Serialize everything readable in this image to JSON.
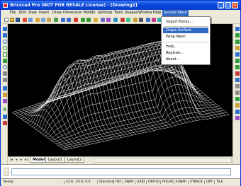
{
  "window": {
    "title": "Bricscad Pro (NOT FOR RESALE License) - [Drawing2]",
    "controls": [
      "_",
      "□",
      "×"
    ]
  },
  "menubar": {
    "items": [
      "File",
      "Edit",
      "View",
      "Insert",
      "Draw",
      "Dimension",
      "Modify",
      "Settings",
      "Tools",
      "Images",
      "Window",
      "Help",
      "Sycode Mesh"
    ],
    "active": "Sycode Mesh"
  },
  "dropdown": {
    "items": [
      {
        "label": "Import Points..."
      },
      {
        "label": "Drape Surface"
      },
      {
        "label": "Wrap Mesh"
      },
      {
        "label": "Help..."
      },
      {
        "label": "Register..."
      },
      {
        "label": "About..."
      }
    ],
    "highlighted": "Drape Surface"
  },
  "tabs": {
    "items": [
      "Model",
      "Layout1",
      "Layout2"
    ],
    "active": "Model"
  },
  "status": {
    "ready": "Ready",
    "coords": "31.6, -25.6, 0.0",
    "style": "Standard",
    "iso": "ISO",
    "toggles": [
      "SNAP",
      "GRID",
      "ORTHO",
      "POLAR",
      "ESNAP",
      "STRACK",
      "LWT",
      "TILE"
    ]
  },
  "colors": {
    "titlebar": "#0a46d9",
    "highlight": "#316ac5",
    "canvas": "#000000",
    "mesh": "#ffffff"
  }
}
